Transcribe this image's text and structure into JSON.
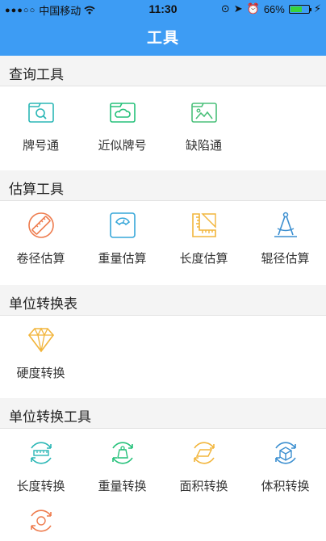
{
  "status": {
    "carrier": "中国移动",
    "time": "11:30",
    "battery": "66%",
    "battery_level": 0.66
  },
  "header": {
    "title": "工具"
  },
  "sections": [
    {
      "title": "查询工具",
      "items": [
        {
          "label": "牌号通",
          "icon": "folder-search-icon",
          "color": "#2bb7b6"
        },
        {
          "label": "近似牌号",
          "icon": "folder-cloud-icon",
          "color": "#25c17a"
        },
        {
          "label": "缺陷通",
          "icon": "folder-image-icon",
          "color": "#4ac07a"
        }
      ]
    },
    {
      "title": "估算工具",
      "items": [
        {
          "label": "卷径估算",
          "icon": "ruler-circle-icon",
          "color": "#ee7b4d"
        },
        {
          "label": "重量估算",
          "icon": "scale-icon",
          "color": "#37a7d9"
        },
        {
          "label": "长度估算",
          "icon": "triangle-ruler-icon",
          "color": "#f2b53b"
        },
        {
          "label": "辊径估算",
          "icon": "compass-icon",
          "color": "#3c8fd0"
        }
      ]
    },
    {
      "title": "单位转换表",
      "items": [
        {
          "label": "硬度转换",
          "icon": "diamond-icon",
          "color": "#f2b53b"
        }
      ]
    },
    {
      "title": "单位转换工具",
      "items": [
        {
          "label": "长度转换",
          "icon": "length-convert-icon",
          "color": "#2bb7b6"
        },
        {
          "label": "重量转换",
          "icon": "weight-convert-icon",
          "color": "#25c17a"
        },
        {
          "label": "面积转换",
          "icon": "area-convert-icon",
          "color": "#f2b53b"
        },
        {
          "label": "体积转换",
          "icon": "volume-convert-icon",
          "color": "#3c8fd0"
        },
        {
          "label": "",
          "icon": "temperature-convert-icon",
          "color": "#ee7b4d"
        }
      ]
    }
  ]
}
